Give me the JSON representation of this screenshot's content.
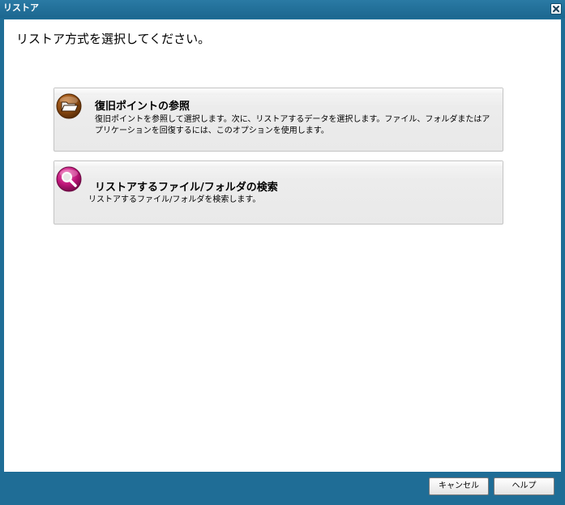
{
  "window": {
    "title": "リストア"
  },
  "main": {
    "heading": "リストア方式を選択してください。",
    "options": [
      {
        "title": "復旧ポイントの参照",
        "description": "復旧ポイントを参照して選択します。次に、リストアするデータを選択します。ファイル、フォルダまたはアプリケーションを回復するには、このオプションを使用します。",
        "icon": "folder-open-icon"
      },
      {
        "title": "リストアするファイル/フォルダの検索",
        "description": "リストアするファイル/フォルダを検索します。",
        "icon": "search-icon"
      }
    ]
  },
  "footer": {
    "cancel_label": "キャンセル",
    "help_label": "ヘルプ"
  },
  "colors": {
    "frame": "#1f6d96",
    "folder_icon": "#8b4a12",
    "search_icon": "#c0167a"
  }
}
